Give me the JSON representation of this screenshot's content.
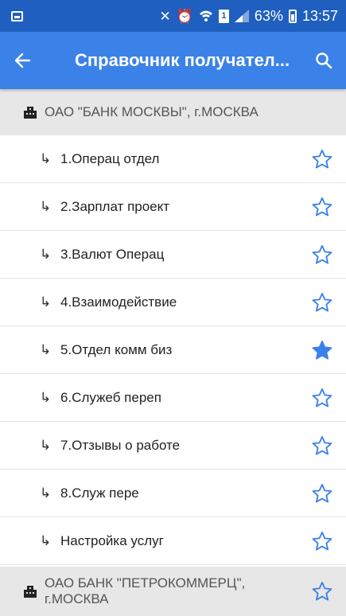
{
  "status_bar": {
    "battery_percent": "63%",
    "time": "13:57",
    "sim_label": "1"
  },
  "app_bar": {
    "title": "Справочник получател..."
  },
  "groups": [
    {
      "name": "ОАО \"БАНК МОСКВЫ\", г.МОСКВА",
      "items": [
        {
          "label": "1.Операц отдел",
          "favorite": false
        },
        {
          "label": "2.Зарплат проект",
          "favorite": false
        },
        {
          "label": "3.Валют Операц",
          "favorite": false
        },
        {
          "label": "4.Взаимодействие",
          "favorite": false
        },
        {
          "label": "5.Отдел комм биз",
          "favorite": true
        },
        {
          "label": "6.Служеб переп",
          "favorite": false
        },
        {
          "label": "7.Отзывы о работе",
          "favorite": false
        },
        {
          "label": "8.Служ пере",
          "favorite": false
        },
        {
          "label": "Настройка услуг",
          "favorite": false
        }
      ]
    },
    {
      "name_line1": "ОАО БАНК \"ПЕТРОКОММЕРЦ\",",
      "name_line2": "г.МОСКВА",
      "favorite": false
    }
  ],
  "colors": {
    "status_bar": "#1f5fbf",
    "app_bar": "#3b82e8",
    "star": "#3b82e8",
    "group_bg": "#e7e7e7"
  }
}
